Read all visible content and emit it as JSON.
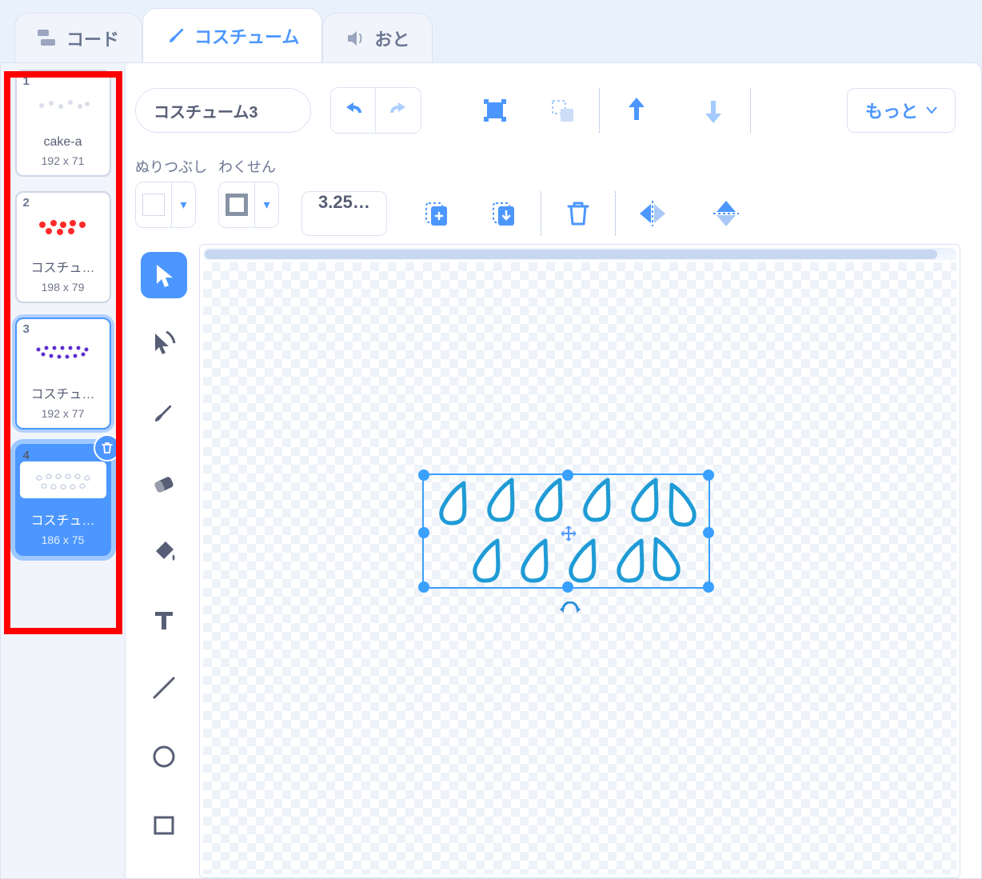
{
  "tabs": {
    "code": "コード",
    "costumes": "コスチューム",
    "sounds": "おと"
  },
  "costumes": [
    {
      "num": "1",
      "name": "cake-a",
      "size": "192 x 71"
    },
    {
      "num": "2",
      "name": "コスチュ…",
      "size": "198 x 79"
    },
    {
      "num": "3",
      "name": "コスチュ…",
      "size": "192 x 77"
    },
    {
      "num": "4",
      "name": "コスチュ…",
      "size": "186 x 75"
    }
  ],
  "editor": {
    "name_value": "コスチューム3",
    "more_label": "もっと",
    "fill_label": "ぬりつぶし",
    "outline_label": "わくせん",
    "thickness_label": "3.25…"
  },
  "colors": {
    "accent": "#4c97ff",
    "highlight": "#ff0000"
  }
}
